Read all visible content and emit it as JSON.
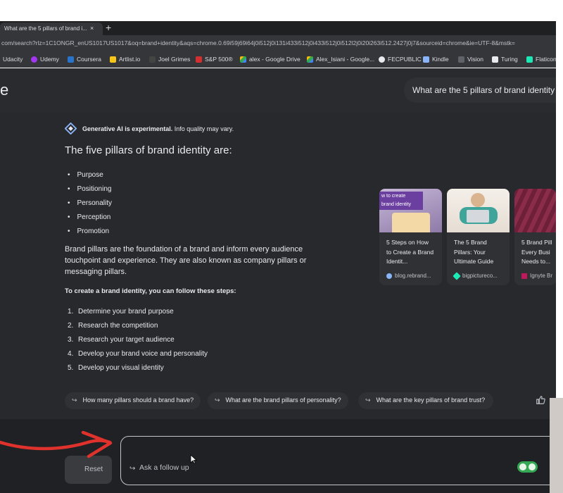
{
  "browser": {
    "tab_title": "What are the 5 pillars of brand i...",
    "tab_close": "×",
    "new_tab": "+",
    "url": "com/search?rlz=1C1ONGR_enUS1017US1017&oq=brand+identity&aqs=chrome.0.69i59j69i64j0i512j0i131i433i512j0i433i512j0i512l2j0i20i263i512.2427j0j7&sourceid=chrome&ie=UTF-8&mstk=",
    "bookmarks": [
      {
        "label": "Udacity",
        "color": "#02b3e4"
      },
      {
        "label": "Udemy",
        "color": "#a435f0"
      },
      {
        "label": "Coursera",
        "color": "#2a73cc"
      },
      {
        "label": "Artlist.io",
        "color": "#f5c518"
      },
      {
        "label": "Joel Grimes",
        "color": "#444444"
      },
      {
        "label": "S&P 500®",
        "color": "#d32f2f"
      },
      {
        "label": "alex - Google Drive",
        "color": "#fbbc04"
      },
      {
        "label": "Alex_Isiani - Google...",
        "color": "#4285f4"
      },
      {
        "label": "FECPUBLIC",
        "color": "#e8eaed"
      },
      {
        "label": "Kindle",
        "color": "#8ab4f8"
      },
      {
        "label": "Vision",
        "color": "#9aa0a6"
      },
      {
        "label": "Turing",
        "color": "#e8eaed"
      },
      {
        "label": "Flaticon",
        "color": "#1de9b6"
      }
    ]
  },
  "header": {
    "logo_fragment": "e",
    "search_query": "What are the 5 pillars of brand identity"
  },
  "ai": {
    "experimental_bold": "Generative AI is experimental.",
    "experimental_rest": " Info quality may vary.",
    "heading": "The five pillars of brand identity are:",
    "pillars": [
      "Purpose",
      "Positioning",
      "Personality",
      "Perception",
      "Promotion"
    ],
    "paragraph": "Brand pillars are the foundation of a brand and inform every audience touchpoint and experience. They are also known as company pillars or messaging pillars.",
    "steps_heading": "To create a brand identity, you can follow these steps:",
    "steps": [
      {
        "num": "1.",
        "text": "Determine your brand purpose"
      },
      {
        "num": "2.",
        "text": "Research the competition"
      },
      {
        "num": "3.",
        "text": "Research your target audience"
      },
      {
        "num": "4.",
        "text": "Develop your brand voice and personality"
      },
      {
        "num": "5.",
        "text": "Develop your visual identity"
      }
    ]
  },
  "cards": [
    {
      "thumb_text": "w to create\nbrand identity",
      "title": "5 Steps on How to Create a Brand Identit...",
      "source": "blog.rebrand...",
      "source_color": "#8ab4f8"
    },
    {
      "thumb_text": "",
      "title": "The 5 Brand Pillars: Your Ultimate Guide",
      "source": "bigpictureco...",
      "source_color": "#1de9b6"
    },
    {
      "thumb_text": "",
      "title": "5 Brand Pill Every Busi Needs to...",
      "source": "Ignyte Br",
      "source_color": "#c2185b"
    }
  ],
  "chips": [
    "How many pillars should a brand have?",
    "What are the brand pillars of personality?",
    "What are the key pillars of brand trust?"
  ],
  "chip_arrow": "↪",
  "bottom": {
    "reset_label": "Reset",
    "followup_placeholder": "Ask a follow up",
    "followup_arrow": "↪"
  },
  "colors": {
    "page_bg": "#202124",
    "panel_bg": "#28292c",
    "annotation_arrow": "#e0322c",
    "extension_green": "#34a853"
  }
}
